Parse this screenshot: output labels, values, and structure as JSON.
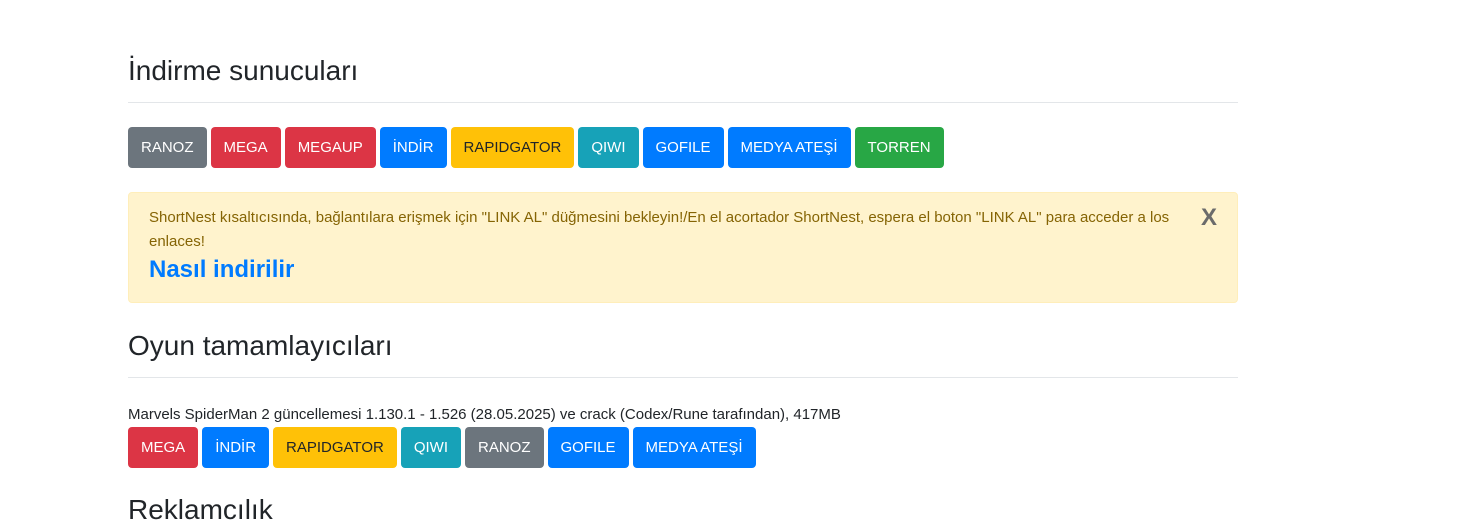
{
  "servers": {
    "title": "İndirme sunucuları",
    "buttons": [
      {
        "label": "RANOZ"
      },
      {
        "label": "MEGA"
      },
      {
        "label": "MEGAUP"
      },
      {
        "label": "İNDİR"
      },
      {
        "label": "RAPIDGATOR"
      },
      {
        "label": "QIWI"
      },
      {
        "label": "GOFILE"
      },
      {
        "label": "MEDYA ATEŞİ"
      },
      {
        "label": "TORREN"
      }
    ]
  },
  "alert": {
    "text": "ShortNest kısaltıcısında, bağlantılara erişmek için \"LINK AL\" düğmesini bekleyin!/En el acortador ShortNest, espera el boton \"LINK AL\" para acceder a los enlaces!",
    "link": "Nasıl indirilir",
    "close": "X"
  },
  "games": {
    "title": "Oyun tamamlayıcıları",
    "item_desc": "Marvels SpiderMan 2 güncellemesi 1.130.1 - 1.526 (28.05.2025) ve crack (Codex/Rune tarafından), 417MB",
    "buttons": [
      {
        "label": "MEGA"
      },
      {
        "label": "İNDİR"
      },
      {
        "label": "RAPIDGATOR"
      },
      {
        "label": "QIWI"
      },
      {
        "label": "RANOZ"
      },
      {
        "label": "GOFILE"
      },
      {
        "label": "MEDYA ATEŞİ"
      }
    ]
  },
  "ads": {
    "title": "Reklamcılık"
  },
  "colors": {
    "gray": "#6c757d",
    "red": "#dc3545",
    "blue": "#007bff",
    "yellow": "#ffc107",
    "teal": "#17a2b8",
    "green": "#28a745",
    "alert_bg": "#fff3cd",
    "alert_text": "#856404"
  }
}
